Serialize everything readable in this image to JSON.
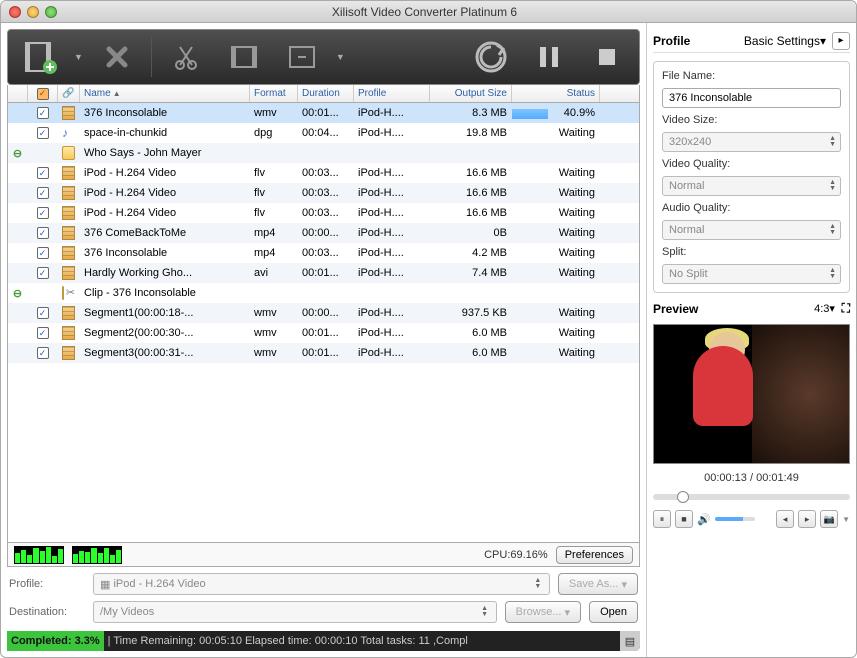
{
  "window": {
    "title": "Xilisoft Video Converter Platinum 6"
  },
  "columns": {
    "name": "Name",
    "format": "Format",
    "duration": "Duration",
    "profile": "Profile",
    "output_size": "Output Size",
    "status": "Status"
  },
  "rows": [
    {
      "exp": "",
      "chk": true,
      "icon": "video",
      "indent": 0,
      "name": "376 Inconsolable",
      "format": "wmv",
      "duration": "00:01...",
      "profile": "iPod-H....",
      "size": "8.3 MB",
      "status": "40.9%",
      "progress": 40.9,
      "running": true
    },
    {
      "exp": "",
      "chk": true,
      "icon": "audio",
      "indent": 0,
      "name": "space-in-chunkid",
      "format": "dpg",
      "duration": "00:04...",
      "profile": "iPod-H....",
      "size": "19.8 MB",
      "status": "Waiting"
    },
    {
      "exp": "⊖",
      "chk": "",
      "icon": "folder",
      "indent": 0,
      "name": "Who Says - John Mayer",
      "format": "",
      "duration": "",
      "profile": "",
      "size": "",
      "status": ""
    },
    {
      "exp": "",
      "chk": true,
      "icon": "video",
      "indent": 1,
      "name": "iPod - H.264 Video",
      "format": "flv",
      "duration": "00:03...",
      "profile": "iPod-H....",
      "size": "16.6 MB",
      "status": "Waiting"
    },
    {
      "exp": "",
      "chk": true,
      "icon": "video",
      "indent": 1,
      "name": "iPod - H.264 Video",
      "format": "flv",
      "duration": "00:03...",
      "profile": "iPod-H....",
      "size": "16.6 MB",
      "status": "Waiting"
    },
    {
      "exp": "",
      "chk": true,
      "icon": "video",
      "indent": 1,
      "name": "iPod - H.264 Video",
      "format": "flv",
      "duration": "00:03...",
      "profile": "iPod-H....",
      "size": "16.6 MB",
      "status": "Waiting"
    },
    {
      "exp": "",
      "chk": true,
      "icon": "video",
      "indent": 0,
      "name": "376 ComeBackToMe",
      "format": "mp4",
      "duration": "00:00...",
      "profile": "iPod-H....",
      "size": "0B",
      "status": "Waiting"
    },
    {
      "exp": "",
      "chk": true,
      "icon": "video",
      "indent": 0,
      "name": "376 Inconsolable",
      "format": "mp4",
      "duration": "00:03...",
      "profile": "iPod-H....",
      "size": "4.2 MB",
      "status": "Waiting"
    },
    {
      "exp": "",
      "chk": true,
      "icon": "video",
      "indent": 0,
      "name": "Hardly Working  Gho...",
      "format": "avi",
      "duration": "00:01...",
      "profile": "iPod-H....",
      "size": "7.4 MB",
      "status": "Waiting"
    },
    {
      "exp": "⊖",
      "chk": "",
      "icon": "folder",
      "indent": 0,
      "name": "Clip - 376 Inconsolable",
      "format": "",
      "duration": "",
      "profile": "",
      "size": "",
      "status": "",
      "clip": true
    },
    {
      "exp": "",
      "chk": true,
      "icon": "video",
      "indent": 1,
      "name": "Segment1(00:00:18-...",
      "format": "wmv",
      "duration": "00:00...",
      "profile": "iPod-H....",
      "size": "937.5 KB",
      "status": "Waiting"
    },
    {
      "exp": "",
      "chk": true,
      "icon": "video",
      "indent": 1,
      "name": "Segment2(00:00:30-...",
      "format": "wmv",
      "duration": "00:01...",
      "profile": "iPod-H....",
      "size": "6.0 MB",
      "status": "Waiting"
    },
    {
      "exp": "",
      "chk": true,
      "icon": "video",
      "indent": 1,
      "name": "Segment3(00:00:31-...",
      "format": "wmv",
      "duration": "00:01...",
      "profile": "iPod-H....",
      "size": "6.0 MB",
      "status": "Waiting"
    }
  ],
  "cpu": {
    "label": "CPU:69.16%",
    "button": "Preferences"
  },
  "bottom": {
    "profile_label": "Profile:",
    "profile_value": "iPod - H.264 Video",
    "saveas": "Save As...",
    "dest_label": "Destination:",
    "dest_value": "/My Videos",
    "browse": "Browse...",
    "open": "Open"
  },
  "status": {
    "completed_label": "Completed:",
    "completed_pct": "3.3%",
    "rest": " | Time Remaining: 00:05:10 Elapsed time: 00:00:10 Total tasks: 11 ,Compl"
  },
  "right": {
    "profile": "Profile",
    "basic": "Basic Settings",
    "filename_label": "File Name:",
    "filename_value": "376 Inconsolable",
    "videosize_label": "Video Size:",
    "videosize_value": "320x240",
    "videoqual_label": "Video Quality:",
    "videoqual_value": "Normal",
    "audioqual_label": "Audio Quality:",
    "audioqual_value": "Normal",
    "split_label": "Split:",
    "split_value": "No Split"
  },
  "preview": {
    "title": "Preview",
    "ratio": "4:3",
    "time": "00:00:13 / 00:01:49",
    "scrub_pct": 12
  }
}
